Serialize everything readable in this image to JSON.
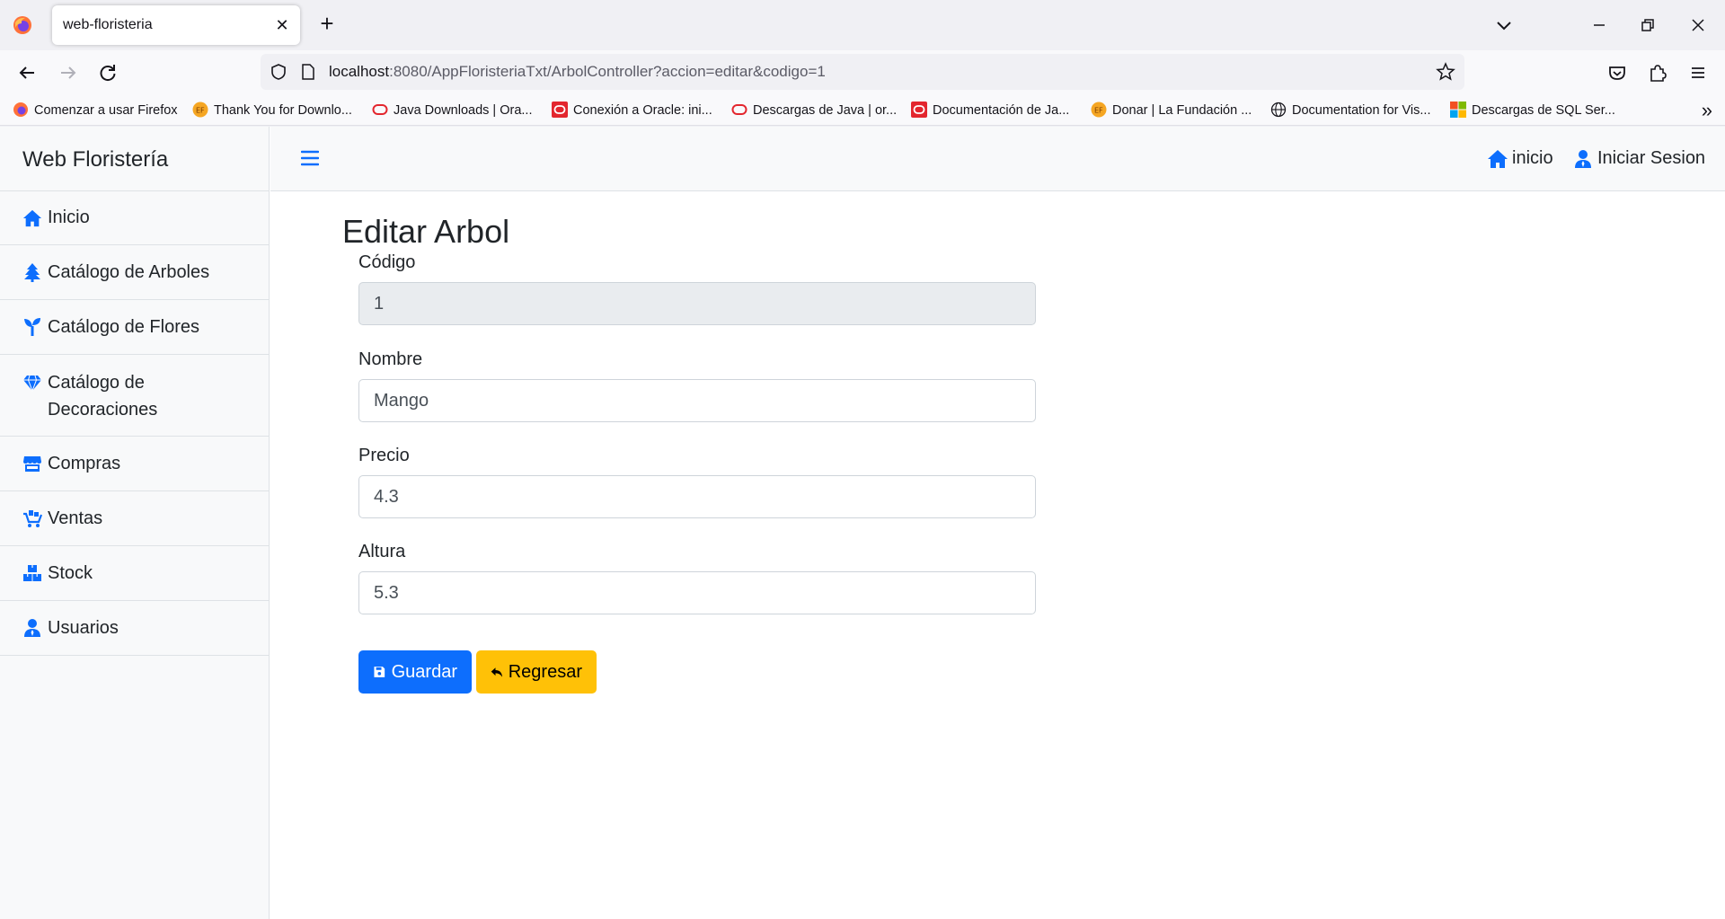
{
  "browser": {
    "tab_title": "web-floristeria",
    "tab_close": "✕",
    "new_tab": "+",
    "url_host": "localhost",
    "url_rest": ":8080/AppFloristeriaTxt/ArbolController?accion=editar&codigo=1",
    "bookmarks": [
      {
        "label": "Comenzar a usar Firefox",
        "icon": "firefox-icon"
      },
      {
        "label": "Thank You for Downlo...",
        "icon": "ef-icon"
      },
      {
        "label": "Java Downloads | Ora...",
        "icon": "oracle-outline-icon"
      },
      {
        "label": "Conexión a Oracle: ini...",
        "icon": "oracle-red-icon"
      },
      {
        "label": "Descargas de Java | or...",
        "icon": "oracle-outline-icon"
      },
      {
        "label": "Documentación de Ja...",
        "icon": "oracle-red-icon"
      },
      {
        "label": "Donar | La Fundación ...",
        "icon": "ef-icon"
      },
      {
        "label": "Documentation for Vis...",
        "icon": "globe-icon"
      },
      {
        "label": "Descargas de SQL Ser...",
        "icon": "microsoft-icon"
      }
    ]
  },
  "app": {
    "brand": "Web Floristería",
    "sidebar": [
      {
        "label": "Inicio",
        "icon": "home-icon"
      },
      {
        "label": "Catálogo de Arboles",
        "icon": "tree-icon"
      },
      {
        "label": "Catálogo de Flores",
        "icon": "seedling-icon"
      },
      {
        "label": "Catálogo de Decoraciones",
        "icon": "gem-icon"
      },
      {
        "label": "Compras",
        "icon": "store-icon"
      },
      {
        "label": "Ventas",
        "icon": "cart-icon"
      },
      {
        "label": "Stock",
        "icon": "boxes-icon"
      },
      {
        "label": "Usuarios",
        "icon": "user-icon"
      }
    ],
    "topnav": {
      "home_label": "inicio",
      "login_label": "Iniciar Sesion"
    }
  },
  "form": {
    "title": "Editar Arbol",
    "codigo_label": "Código",
    "codigo_value": "1",
    "nombre_label": "Nombre",
    "nombre_value": "Mango",
    "precio_label": "Precio",
    "precio_value": "4.3",
    "altura_label": "Altura",
    "altura_value": "5.3",
    "save_label": "Guardar",
    "back_label": "Regresar"
  },
  "colors": {
    "primary": "#0d6efd",
    "warning": "#ffc107",
    "icon_blue": "#0d6efd"
  }
}
